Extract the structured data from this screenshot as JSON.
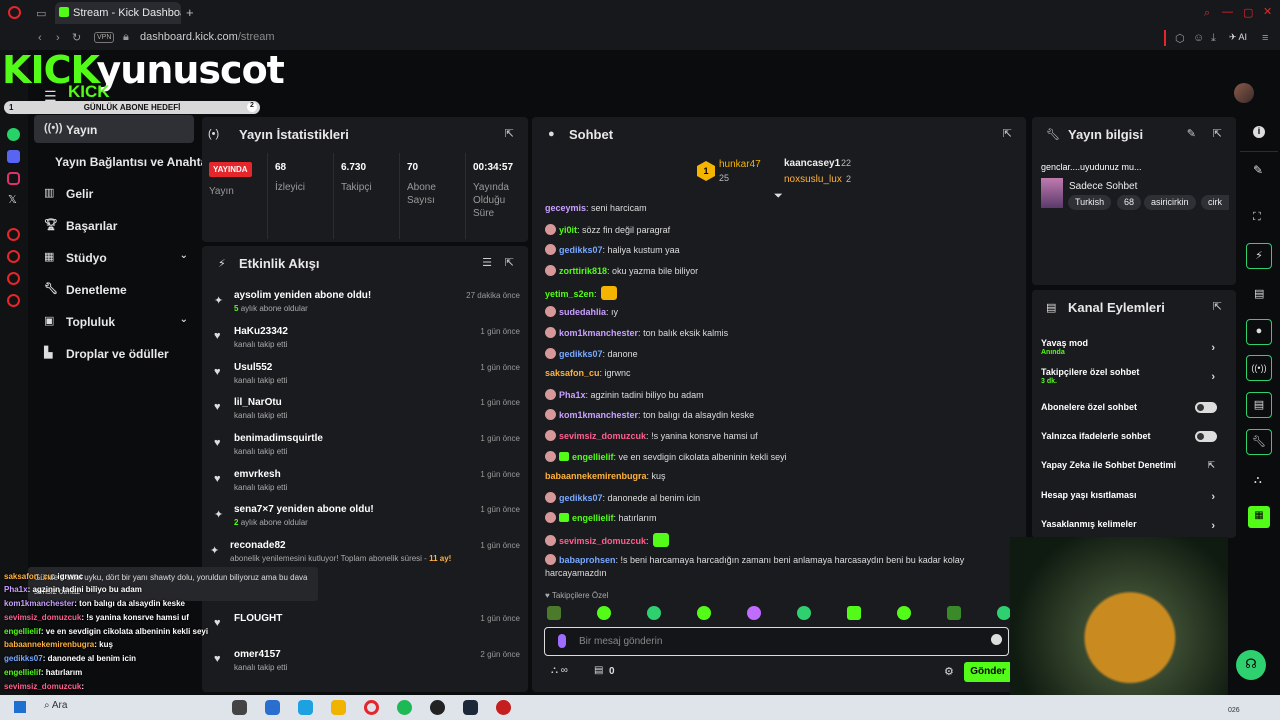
{
  "browser": {
    "tab_title": "Stream - Kick Dashboard",
    "new_tab": "+",
    "vpn": "VPN",
    "url_domain": "dashboard.kick.com",
    "url_path": "/stream",
    "ai_label": "AI"
  },
  "header": {
    "brand_kick": "KICK",
    "brand_name": "yunuscot",
    "brand_small": "KICK",
    "goal_label": "GÜNLÜK ABONE HEDEFİ",
    "goal_current": "1",
    "goal_target": "2"
  },
  "sidebar": {
    "items": [
      {
        "label": "Yayın"
      },
      {
        "label": "Yayın Bağlantısı ve Anahtarı"
      },
      {
        "label": "Gelir"
      },
      {
        "label": "Başarılar"
      },
      {
        "label": "Stüdyo"
      },
      {
        "label": "Denetleme"
      },
      {
        "label": "Topluluk"
      },
      {
        "label": "Droplar ve ödüller"
      }
    ]
  },
  "stats_panel": {
    "title": "Yayın İstatistikleri",
    "live_badge": "YAYINDA",
    "live_label": "Yayın",
    "viewers_value": "68",
    "viewers_label": "İzleyici",
    "followers_value": "6.730",
    "followers_label": "Takipçi",
    "subs_value": "70",
    "subs_label": "Abone Sayısı",
    "uptime_value": "00:34:57",
    "uptime_label": "Yayında Olduğu Süre"
  },
  "events_panel": {
    "title": "Etkinlik Akışı",
    "events": [
      {
        "name": "aysolim yeniden abone oldu!",
        "sub_num": "5",
        "sub": "aylık abone oldular",
        "time": "27 dakika önce"
      },
      {
        "name": "HaKu23342",
        "sub": "kanalı takip etti",
        "time": "1 gün önce"
      },
      {
        "name": "Usul552",
        "sub": "kanalı takip etti",
        "time": "1 gün önce"
      },
      {
        "name": "lil_NarOtu",
        "sub": "kanalı takip etti",
        "time": "1 gün önce"
      },
      {
        "name": "benimadimsquirtle",
        "sub": "kanalı takip etti",
        "time": "1 gün önce"
      },
      {
        "name": "emvrkesh",
        "sub": "kanalı takip etti",
        "time": "1 gün önce"
      },
      {
        "name": "sena7×7 yeniden abone oldu!",
        "sub_num": "2",
        "sub": "aylık abone oldular",
        "time": "1 gün önce"
      },
      {
        "name": "reconade82",
        "sub": "abonelik yenilemesini kutluyor! Toplam abonelik süresi -",
        "sub_num": "11 ay!",
        "time": "1 gün önce"
      },
      {
        "name": "FLOUGHT",
        "sub": "kanalı takip etti",
        "time": "1 gün önce"
      },
      {
        "name": "omer4157",
        "sub": "kanalı takip etti",
        "time": "2 gün önce"
      }
    ],
    "quote": "Günde 4 saat uyku, dört bir yanı shawty dolu, yoruldun biliyoruz ama bu dava sensiz olmaz"
  },
  "chat_panel": {
    "title": "Sohbet",
    "top1_name": "hunkar47",
    "top1_count": "25",
    "top2_name": "kaancasey1",
    "top2_count": "22",
    "top3_name": "noxsuslu_lux",
    "top3_count": "2",
    "rank": "1",
    "messages": [
      {
        "user": "geceymis",
        "color": "#c9a0ff",
        "text": "seni harcicam"
      },
      {
        "user": "yi0it",
        "color": "#53fc18",
        "text": "sözz fin değil paragraf"
      },
      {
        "user": "gedikks07",
        "color": "#78a8ff",
        "text": "haliya kustum yaa"
      },
      {
        "user": "zorttirik818",
        "color": "#53fc18",
        "text": "oku yazma bile biliyor"
      },
      {
        "user": "yetim_s2en",
        "color": "#53fc18",
        "text": ""
      },
      {
        "user": "sudedahlia",
        "color": "#c9a0ff",
        "text": "ıy"
      },
      {
        "user": "kom1kmanchester",
        "color": "#c9a0ff",
        "text": "ton balık eksik kalmis"
      },
      {
        "user": "gedikks07",
        "color": "#78a8ff",
        "text": "danone"
      },
      {
        "user": "saksafon_cu",
        "color": "#ffb23e",
        "text": "igrwnc"
      },
      {
        "user": "Pha1x",
        "color": "#c9a0ff",
        "text": "agzinin tadini biliyo bu adam"
      },
      {
        "user": "kom1kmanchester",
        "color": "#c9a0ff",
        "text": "ton balıgı da alsaydin keske"
      },
      {
        "user": "sevimsiz_domuzcuk",
        "color": "#ff5f8f",
        "text": "!s yanina konsrve hamsi uf"
      },
      {
        "user": "engellielif",
        "color": "#53fc18",
        "text": "ve en sevdigin cikolata albeninin kekli seyi"
      },
      {
        "user": "babaannekemirenbugra",
        "color": "#ffb23e",
        "text": "kuş"
      },
      {
        "user": "gedikks07",
        "color": "#78a8ff",
        "text": "danonede al benim icin"
      },
      {
        "user": "engellielif",
        "color": "#53fc18",
        "text": "hatırlarım"
      },
      {
        "user": "sevimsiz_domuzcuk",
        "color": "#ff5f8f",
        "text": ""
      },
      {
        "user": "babaprohsen",
        "color": "#78a8ff",
        "text": "!s beni harcamaya harcadığın zamanı beni anlamaya harcasaydın beni bu kadar kolay"
      }
    ],
    "last_wrap": "harcayamazdın",
    "follower_only": "Takipçilere Özel",
    "placeholder": "Bir mesaj gönderin",
    "points": "0",
    "send": "Gönder"
  },
  "info_panel": {
    "title": "Yayın bilgisi",
    "stream_title": "genclar....uyudunuz mu...",
    "category": "Sadece Sohbet",
    "tags": [
      "Turkish",
      "68",
      "asiricirkin",
      "cirk"
    ]
  },
  "actions_panel": {
    "title": "Kanal Eylemleri",
    "items": [
      {
        "label": "Yavaş mod",
        "sub": "Anında"
      },
      {
        "label": "Takipçilere özel sohbet",
        "sub": "3 dk."
      },
      {
        "label": "Abonelere özel sohbet"
      },
      {
        "label": "Yalnızca ifadelerle sohbet"
      },
      {
        "label": "Yapay Zeka ile Sohbet Denetimi"
      },
      {
        "label": "Hesap yaşı kısıtlaması"
      },
      {
        "label": "Yasaklanmış kelimeler"
      }
    ]
  },
  "overlay_chat": [
    {
      "user": "saksafon_cu",
      "color": "#ffb23e",
      "text": ": igrwnc"
    },
    {
      "user": "Pha1x",
      "color": "#c9a0ff",
      "text": ": agzinin tadini biliyo bu adam"
    },
    {
      "user": "kom1kmanchester",
      "color": "#c9a0ff",
      "text": ": ton balıgı da alsaydin keske"
    },
    {
      "user": "sevimsiz_domuzcuk",
      "color": "#ff5f8f",
      "text": ": !s yanina konsrve hamsi uf"
    },
    {
      "user": "engellielif",
      "color": "#53fc18",
      "text": ": ve en sevdigin cikolata albeninin kekli seyi"
    },
    {
      "user": "babaannekemirenbugra",
      "color": "#ffb23e",
      "text": ": kuş"
    },
    {
      "user": "gedikks07",
      "color": "#78a8ff",
      "text": ": danonede al benim icin"
    },
    {
      "user": "engellielif",
      "color": "#53fc18",
      "text": ": hatırlarım"
    },
    {
      "user": "sevimsiz_domuzcuk",
      "color": "#ff5f8f",
      "text": ":"
    }
  ],
  "taskbar": {
    "search": "Ara",
    "clock": "026"
  },
  "colors": {
    "accent": "#53fc18",
    "live": "#e5262b"
  }
}
